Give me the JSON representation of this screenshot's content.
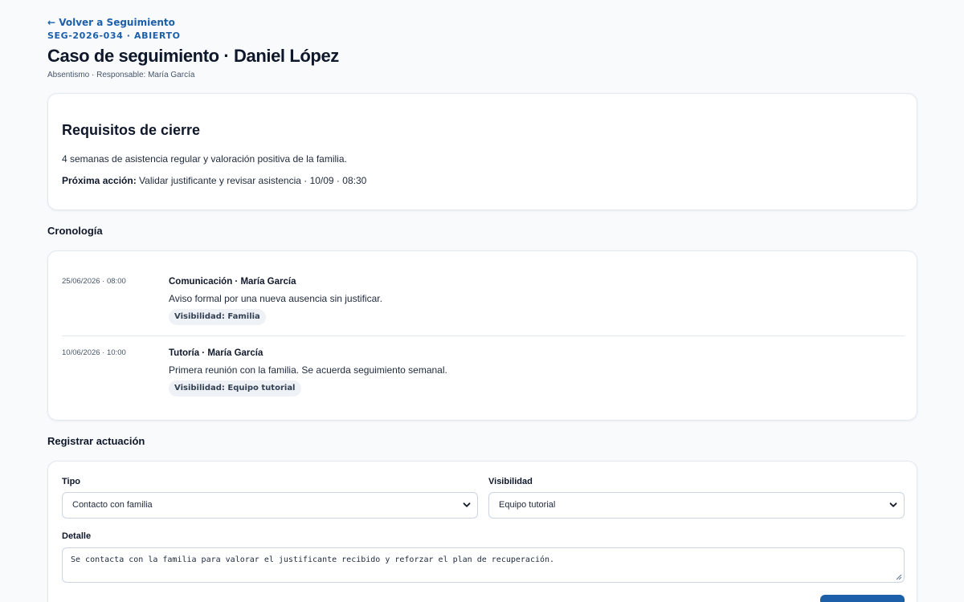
{
  "header": {
    "back_link": "← Volver a Seguimiento",
    "case_code": "SEG-2026-034 · ABIERTO",
    "title": "Caso de seguimiento · Daniel López",
    "subtitle": "Absentismo · Responsable: María García"
  },
  "requirements": {
    "title": "Requisitos de cierre",
    "text": "4 semanas de asistencia regular y valoración positiva de la familia.",
    "next_action_label": "Próxima acción:",
    "next_action_value": "Validar justificante y revisar asistencia · 10/09 · 08:30"
  },
  "timeline": {
    "heading": "Cronología",
    "entries": [
      {
        "date": "25/06/2026 · 08:00",
        "title": "Comunicación · María García",
        "description": "Aviso formal por una nueva ausencia sin justificar.",
        "visibility": "Visibilidad: Familia"
      },
      {
        "date": "10/06/2026 · 10:00",
        "title": "Tutoría · María García",
        "description": "Primera reunión con la familia. Se acuerda seguimiento semanal.",
        "visibility": "Visibilidad: Equipo tutorial"
      }
    ]
  },
  "form": {
    "heading": "Registrar actuación",
    "tipo_label": "Tipo",
    "tipo_value": "Contacto con familia",
    "visibilidad_label": "Visibilidad",
    "visibilidad_value": "Equipo tutorial",
    "detalle_label": "Detalle",
    "detalle_value": "Se contacta con la familia para valorar el justificante recibido y reforzar el plan de recuperación.",
    "submit_label": ""
  },
  "icons": {
    "select_arrow": "chevron-down-icon",
    "resize_handle": "resize-grip-icon"
  },
  "colors": {
    "accent": "#1d5fa8",
    "background": "#f8fafc",
    "card": "#ffffff",
    "badge_bg": "#eef1f5"
  }
}
